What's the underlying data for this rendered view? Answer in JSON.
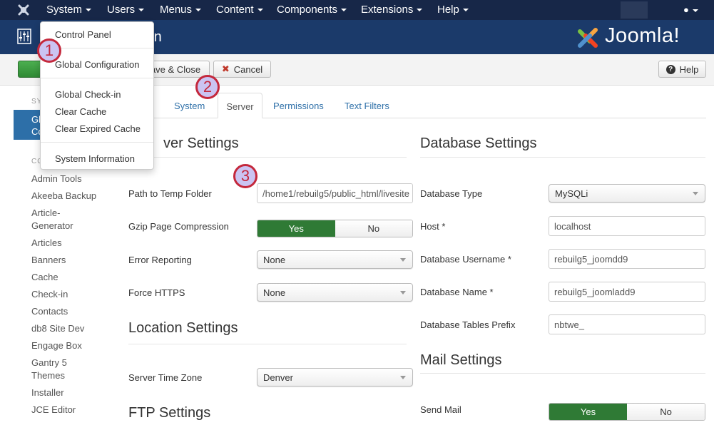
{
  "topnav": {
    "items": [
      "System",
      "Users",
      "Menus",
      "Content",
      "Components",
      "Extensions",
      "Help"
    ],
    "user_icon": "user-icon"
  },
  "header": {
    "title_fragment": "ion",
    "logo_text": "Joomla!"
  },
  "toolbar": {
    "save_close": "Save & Close",
    "save_close_visible": "ave & Close",
    "cancel": "Cancel",
    "help": "Help"
  },
  "system_menu": {
    "items": [
      "Control Panel",
      "Global Configuration",
      "Global Check-in",
      "Clear Cache",
      "Clear Expired Cache",
      "System Information"
    ]
  },
  "sidebar": {
    "heading_system": "SY",
    "active_item_line1": "Gl",
    "active_item_line2": "Co",
    "heading_components": "CO",
    "items": [
      "Admin Tools",
      "Akeeba Backup",
      "Article-Generator",
      "Articles",
      "Banners",
      "Cache",
      "Check-in",
      "Contacts",
      "db8 Site Dev",
      "Engage Box",
      "Gantry 5 Themes",
      "Installer",
      "JCE Editor"
    ]
  },
  "tabs": [
    "System",
    "Server",
    "Permissions",
    "Text Filters"
  ],
  "active_tab": "Server",
  "server_settings": {
    "heading": "ver Settings",
    "fields": {
      "temp_path": {
        "label": "Path to Temp Folder",
        "value": "/home1/rebuilg5/public_html/livesite"
      },
      "gzip": {
        "label": "Gzip Page Compression",
        "yes": "Yes",
        "no": "No",
        "selected": "Yes"
      },
      "error_reporting": {
        "label": "Error Reporting",
        "value": "None"
      },
      "force_https": {
        "label": "Force HTTPS",
        "value": "None"
      }
    }
  },
  "location_settings": {
    "heading": "Location Settings",
    "timezone_label": "Server Time Zone",
    "timezone_value": "Denver"
  },
  "ftp_settings": {
    "heading": "FTP Settings"
  },
  "database_settings": {
    "heading": "Database Settings",
    "type": {
      "label": "Database Type",
      "value": "MySQLi"
    },
    "host": {
      "label": "Host *",
      "value": "localhost"
    },
    "username": {
      "label": "Database Username *",
      "value": "rebuilg5_joomdd9"
    },
    "name": {
      "label": "Database Name *",
      "value": "rebuilg5_joomladd9"
    },
    "prefix": {
      "label": "Database Tables Prefix",
      "value": "nbtwe_"
    }
  },
  "mail_settings": {
    "heading": "Mail Settings",
    "send_mail_label": "Send Mail",
    "yes": "Yes",
    "no": "No",
    "selected": "Yes"
  },
  "annotations": [
    "1",
    "2",
    "3"
  ],
  "colors": {
    "topnav": "#172748",
    "header": "#1b3a6a",
    "toggle_on": "#2f7a35",
    "link": "#3071a9",
    "annotation_border": "#c4283c",
    "annotation_fill": "#cbc4f2"
  }
}
